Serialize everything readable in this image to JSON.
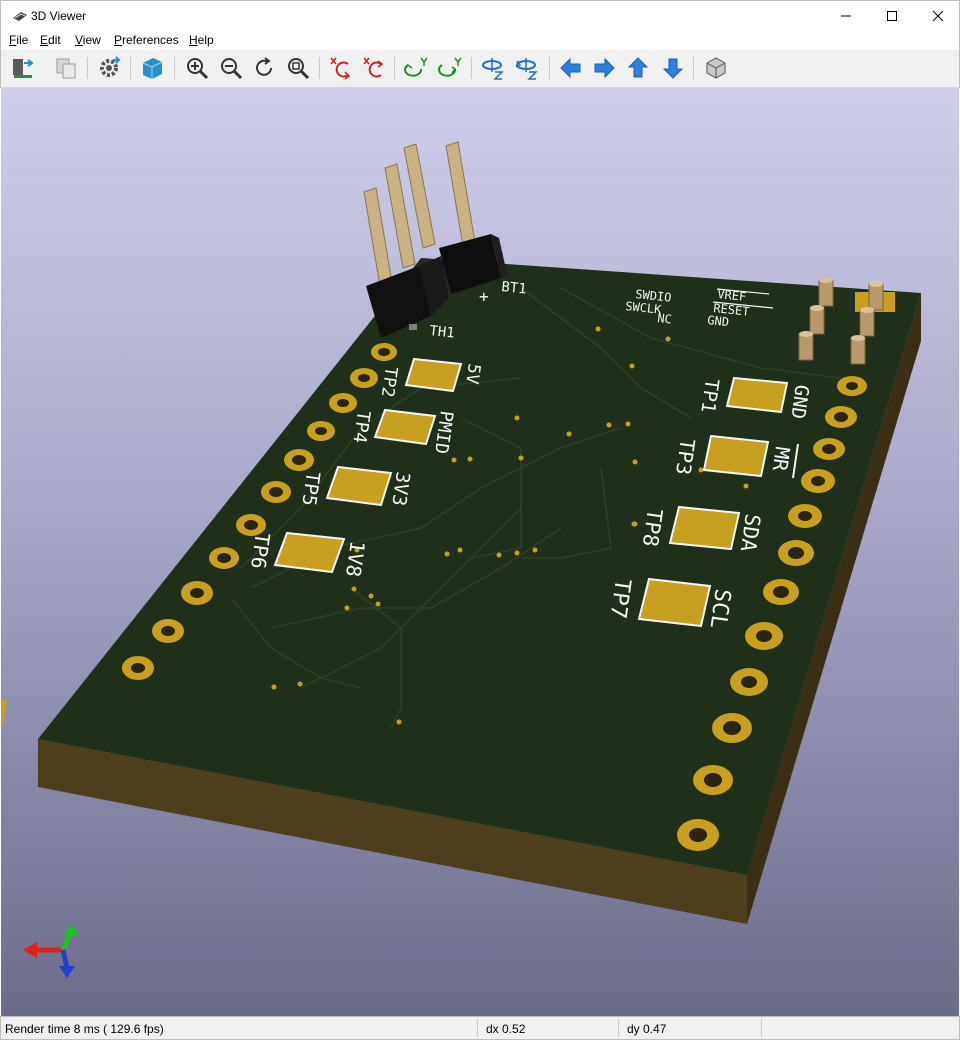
{
  "window": {
    "title": "3D Viewer"
  },
  "menu": [
    {
      "label": "File",
      "accel": "F",
      "rest": "ile"
    },
    {
      "label": "Edit",
      "accel": "E",
      "rest": "dit"
    },
    {
      "label": "View",
      "accel": "V",
      "rest": "iew"
    },
    {
      "label": "Preferences",
      "accel": "P",
      "rest": "references"
    },
    {
      "label": "Help",
      "accel": "H",
      "rest": "elp"
    }
  ],
  "toolbar": {
    "icons": [
      "reload-board-icon",
      "copy-image-icon",
      "settings-icon",
      "raytrace-icon",
      "zoom-in-icon",
      "zoom-out-icon",
      "redraw-icon",
      "zoom-fit-icon",
      "rotate-x-ccw-icon",
      "rotate-x-cw-icon",
      "rotate-y-ccw-icon",
      "rotate-y-cw-icon",
      "rotate-z-ccw-icon",
      "rotate-z-cw-icon",
      "move-left-icon",
      "move-right-icon",
      "move-up-icon",
      "move-down-icon",
      "ortho-toggle-icon"
    ]
  },
  "board": {
    "header_labels": {
      "th1": "TH1",
      "bt1": "BT1",
      "plus": "+"
    },
    "swd_left": [
      "SWDIO",
      "SWCLK",
      "NC"
    ],
    "swd_right": [
      "VREF",
      "RESET",
      "GND"
    ],
    "testpoints_left": [
      {
        "ref": "TP2",
        "net": "5V"
      },
      {
        "ref": "TP4",
        "net": "PMID"
      },
      {
        "ref": "TP5",
        "net": "3V3"
      },
      {
        "ref": "TP6",
        "net": "1V8"
      }
    ],
    "testpoints_right": [
      {
        "ref": "TP1",
        "net": "GND"
      },
      {
        "ref": "TP3",
        "net": "MR"
      },
      {
        "ref": "TP8",
        "net": "SDA"
      },
      {
        "ref": "TP7",
        "net": "SCL"
      }
    ]
  },
  "status": {
    "render": "Render time 8 ms ( 129.6 fps)",
    "dx": "dx 0.52",
    "dy": "dy 0.47"
  },
  "colors": {
    "pcb": "#1f2f1a",
    "pcb_edge": "#4a3c1c",
    "copper": "#c8a020",
    "silkscreen": "#f5f5f5",
    "background_top": "#cfcee9",
    "background_bottom": "#6b6b8a"
  }
}
